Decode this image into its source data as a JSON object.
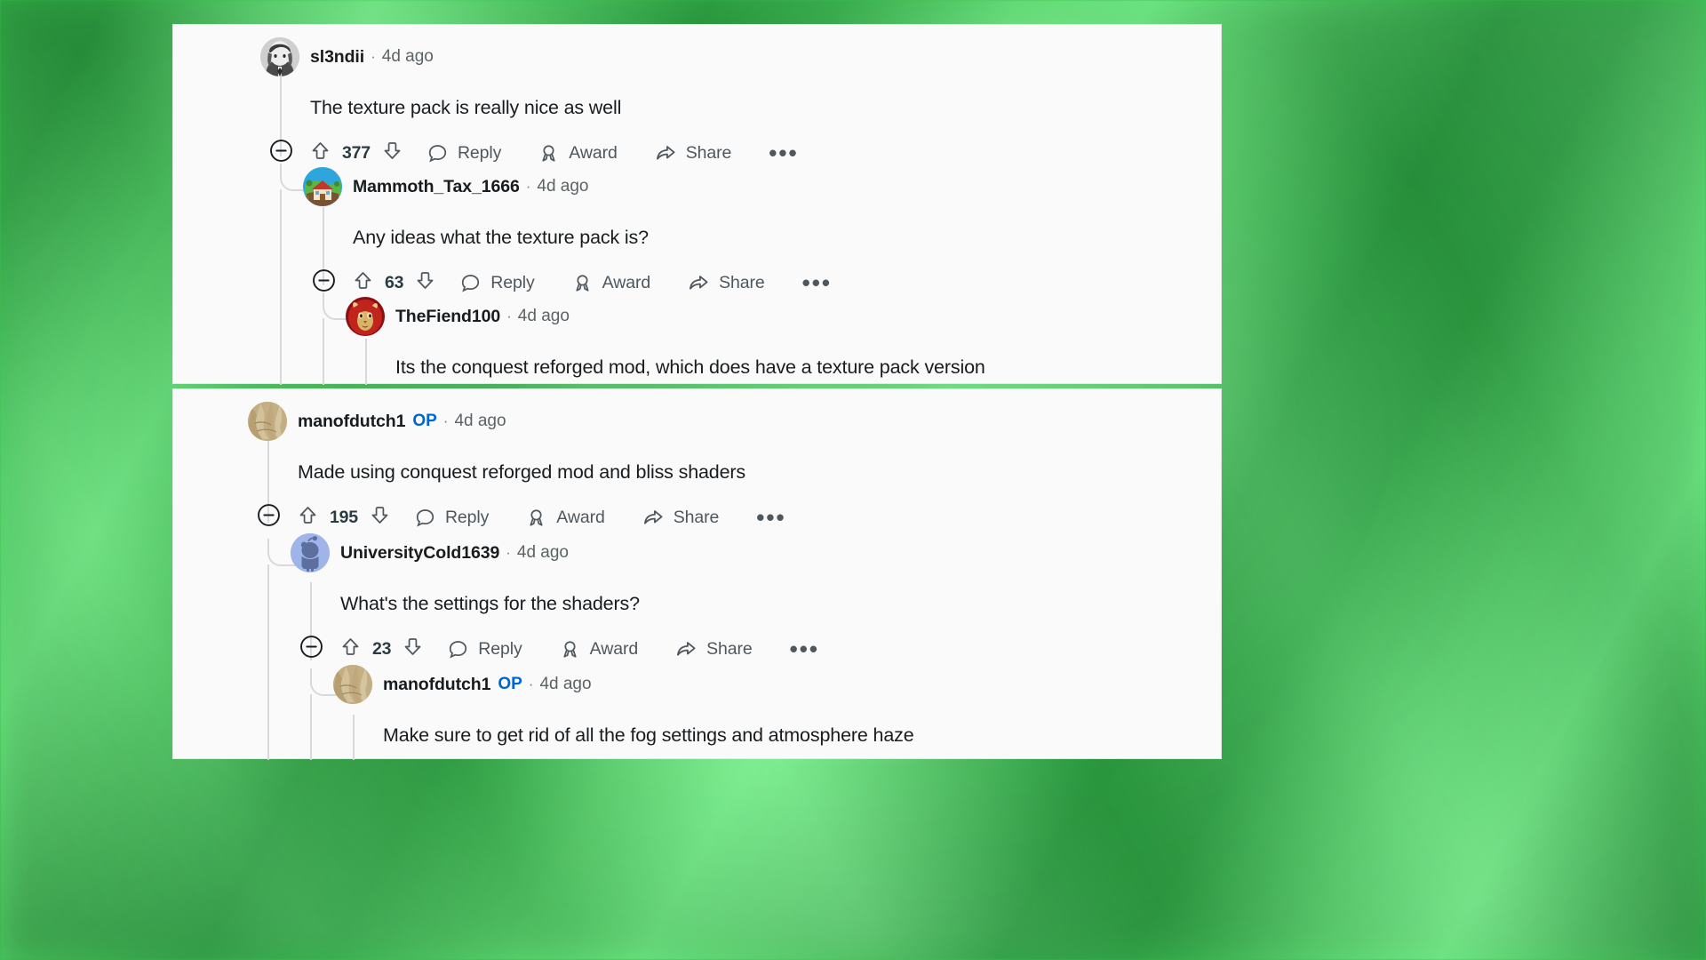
{
  "page": {
    "background_color": "#3fbf4f",
    "card_background": "#fafafa",
    "op_badge_color": "#0064d1"
  },
  "action_labels": {
    "reply": "Reply",
    "award": "Award",
    "share": "Share",
    "more": "•••",
    "collapse_icon": "collapse-icon",
    "upvote_icon": "upvote-arrow-icon",
    "downvote_icon": "downvote-arrow-icon",
    "reply_icon": "comment-bubble-icon",
    "award_icon": "award-ribbon-icon",
    "share_icon": "share-arrow-icon"
  },
  "cards": [
    {
      "id": "card-top",
      "comments": [
        {
          "username": "sl3ndii",
          "op": "",
          "separator": "·",
          "timestamp": "4d ago",
          "body": "The texture pack is really nice as well",
          "score": "377",
          "avatar": "anime-grayscale-portrait-avatar",
          "has_actions": true
        },
        {
          "username": "Mammoth_Tax_1666",
          "op": "",
          "separator": "·",
          "timestamp": "4d ago",
          "body": "Any ideas what the texture pack is?",
          "score": "63",
          "avatar": "village-house-illustration-avatar",
          "has_actions": true
        },
        {
          "username": "TheFiend100",
          "op": "",
          "separator": "·",
          "timestamp": "4d ago",
          "body": "Its the conquest reforged mod, which does have a texture pack version",
          "score": "",
          "avatar": "red-creature-face-avatar",
          "has_actions": false
        }
      ]
    },
    {
      "id": "card-bottom",
      "comments": [
        {
          "username": "manofdutch1",
          "op": "OP",
          "separator": "·",
          "timestamp": "4d ago",
          "body": "Made using conquest reforged mod and bliss shaders",
          "score": "195",
          "avatar": "tan-stone-texture-avatar",
          "has_actions": true
        },
        {
          "username": "UniversityCold1639",
          "op": "",
          "separator": "·",
          "timestamp": "4d ago",
          "body": "What's the settings for the shaders?",
          "score": "23",
          "avatar": "default-reddit-snoo-avatar",
          "has_actions": true
        },
        {
          "username": "manofdutch1",
          "op": "OP",
          "separator": "·",
          "timestamp": "4d ago",
          "body": "Make sure to get rid of all the fog settings and atmosphere haze",
          "score": "",
          "avatar": "tan-stone-texture-avatar",
          "has_actions": false
        }
      ]
    }
  ]
}
